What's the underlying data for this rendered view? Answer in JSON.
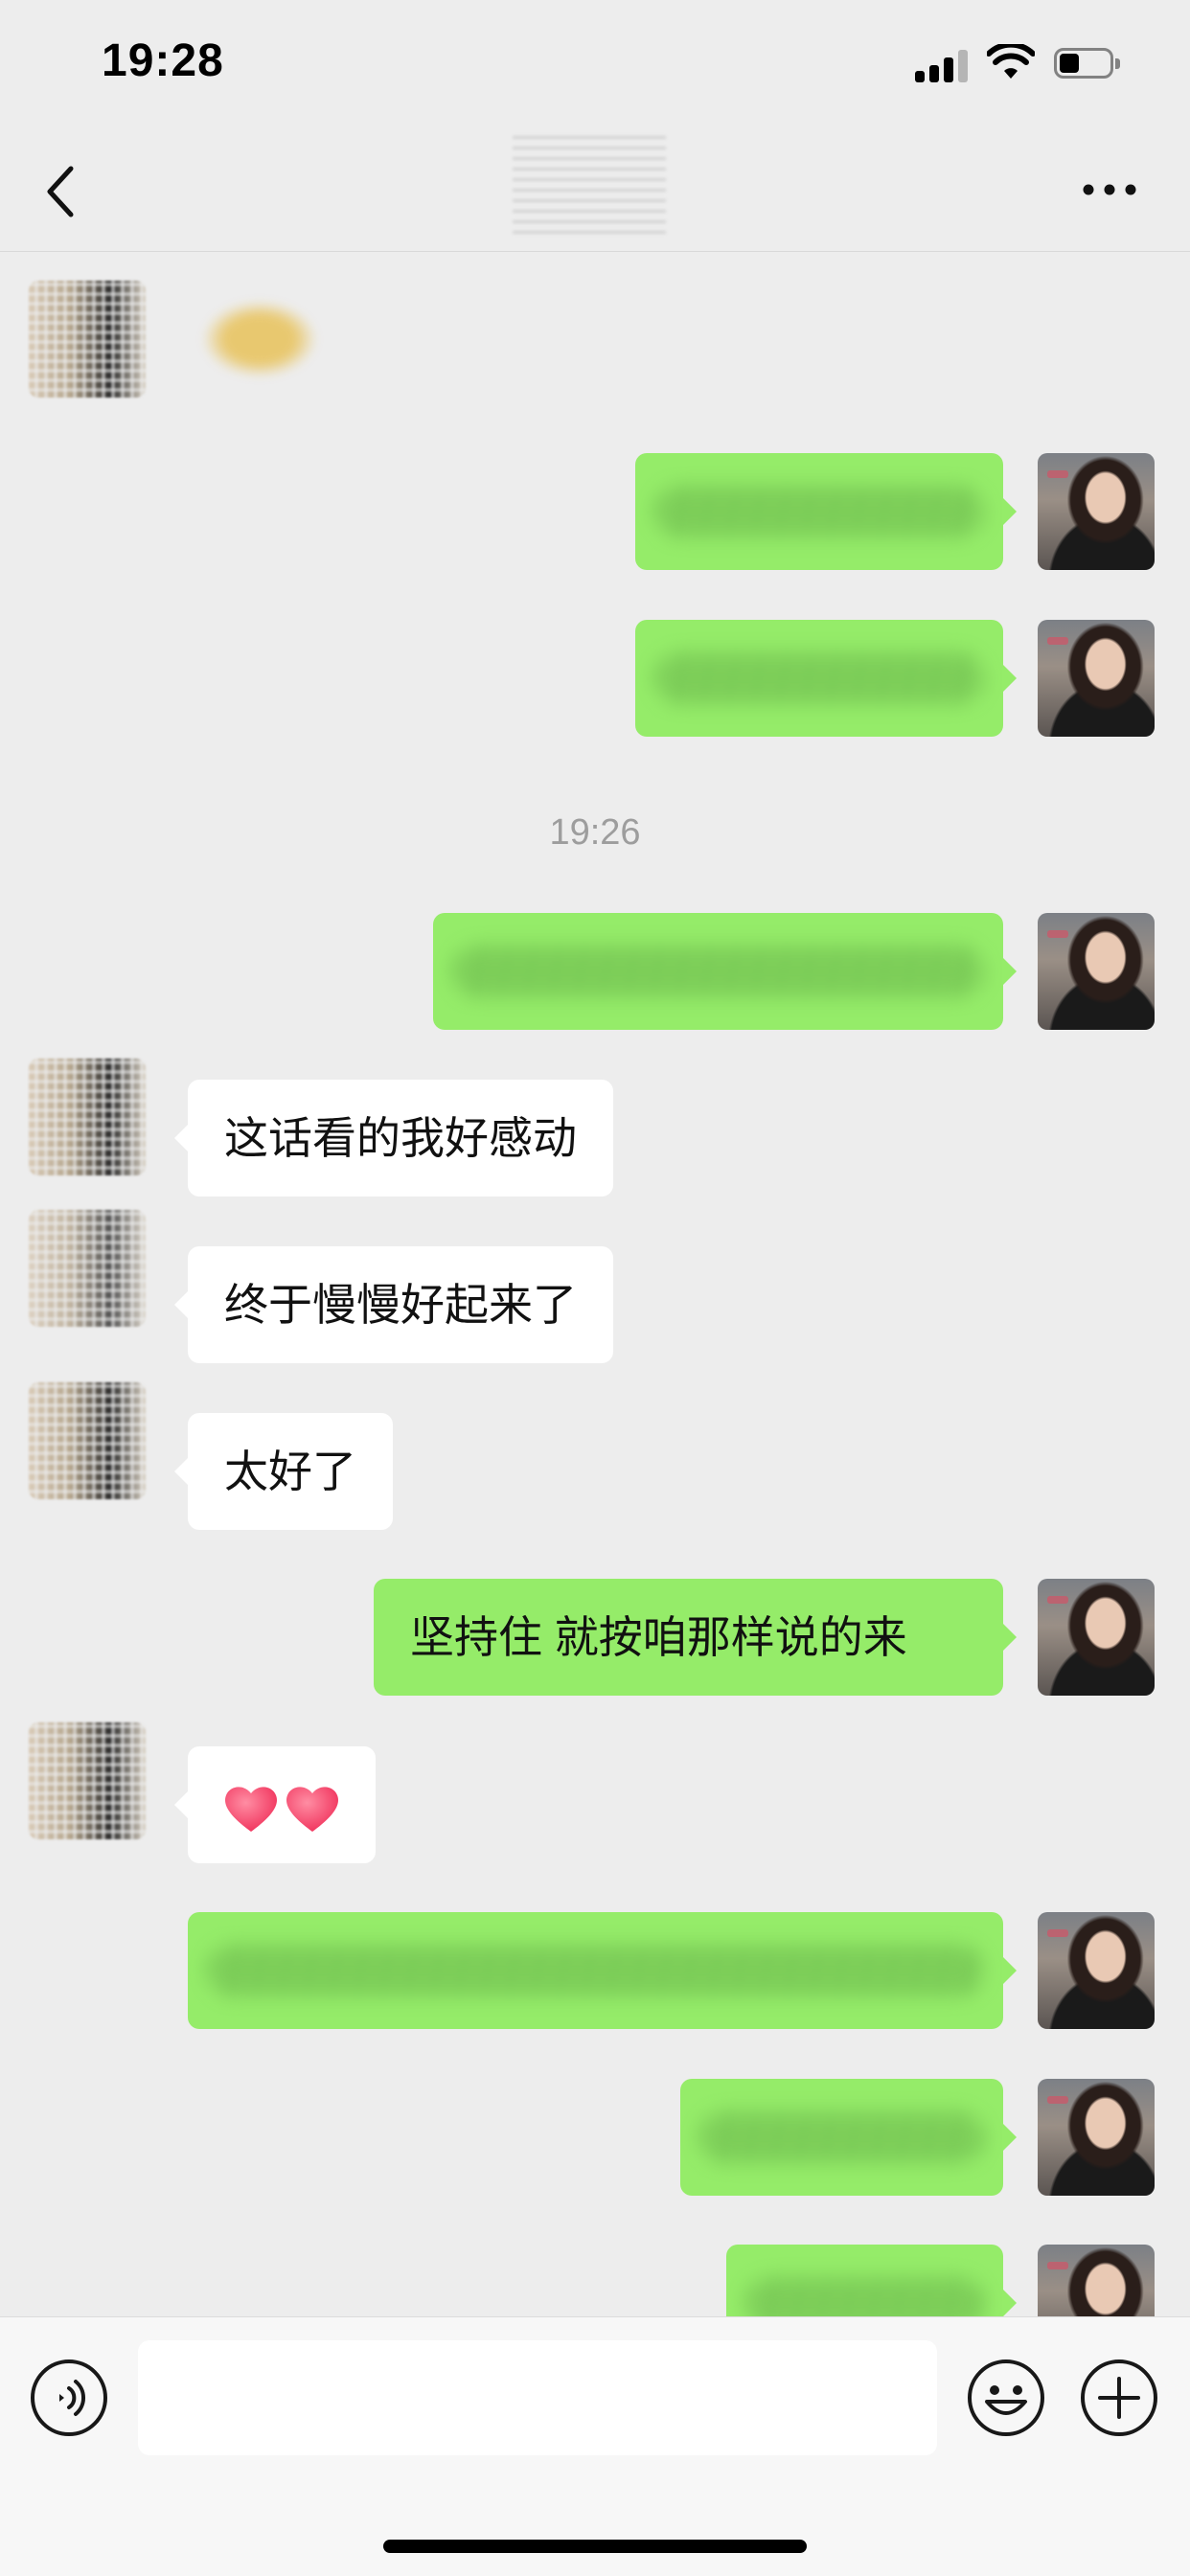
{
  "status_bar": {
    "time": "19:28",
    "battery_level": 0.4
  },
  "nav": {
    "title": ""
  },
  "timestamp": "19:26",
  "messages": [
    {
      "side": "in",
      "kind": "sticker"
    },
    {
      "side": "out",
      "kind": "blurred"
    },
    {
      "side": "out",
      "kind": "blurred"
    },
    {
      "side": "out",
      "kind": "blurred"
    },
    {
      "side": "in",
      "kind": "text",
      "text": "这话看的我好感动"
    },
    {
      "side": "in",
      "kind": "text",
      "text": "终于慢慢好起来了"
    },
    {
      "side": "in",
      "kind": "text",
      "text": "太好了"
    },
    {
      "side": "out",
      "kind": "text",
      "text": "坚持住 就按咱那样说的来"
    },
    {
      "side": "in",
      "kind": "emoji",
      "emoji_name": "two-hearts-icon"
    },
    {
      "side": "out",
      "kind": "blurred"
    },
    {
      "side": "out",
      "kind": "blurred"
    },
    {
      "side": "out",
      "kind": "blurred"
    }
  ],
  "input": {
    "placeholder": ""
  },
  "colors": {
    "outgoing_bubble": "#95ec69",
    "incoming_bubble": "#ffffff",
    "background": "#ededed"
  }
}
